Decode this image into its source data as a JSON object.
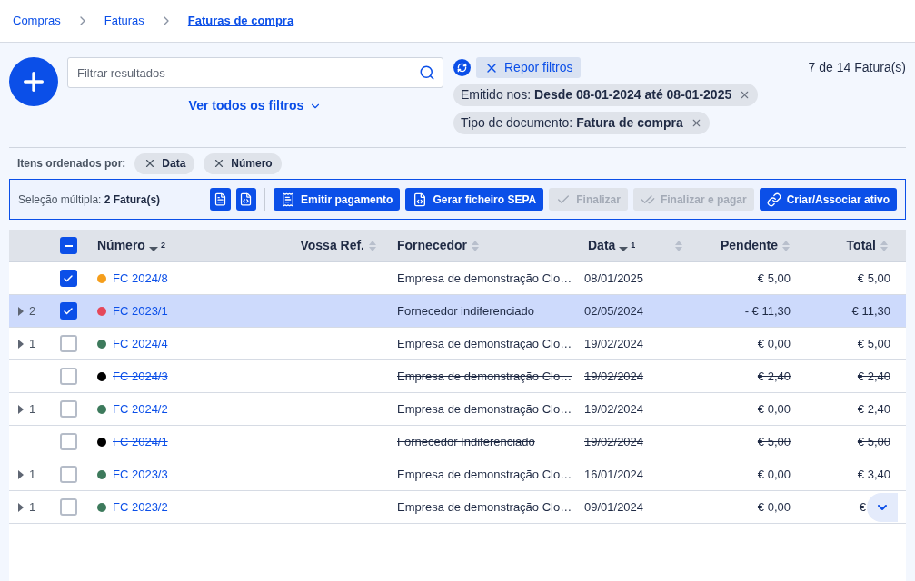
{
  "breadcrumb": [
    {
      "label": "Compras",
      "current": false
    },
    {
      "label": "Faturas",
      "current": false
    },
    {
      "label": "Faturas de compra",
      "current": true
    }
  ],
  "search": {
    "placeholder": "Filtrar resultados"
  },
  "all_filters_link": "Ver todos os filtros",
  "reset_filters": "Repor filtros",
  "result_count": "7 de 14 Fatura(s)",
  "active_filters": [
    {
      "label": "Emitido nos:",
      "value": "Desde 08-01-2024 até 08-01-2025"
    },
    {
      "label": "Tipo de documento:",
      "value": "Fatura de compra"
    }
  ],
  "sort": {
    "label": "Itens ordenados por:",
    "chips": [
      "Data",
      "Número"
    ]
  },
  "selection_bar": {
    "label": "Seleção múltipla:",
    "value": "2 Fatura(s)",
    "buttons": [
      {
        "label": "Emitir pagamento",
        "disabled": false
      },
      {
        "label": "Gerar ficheiro SEPA",
        "disabled": false
      },
      {
        "label": "Finalizar",
        "disabled": true
      },
      {
        "label": "Finalizar e pagar",
        "disabled": true
      },
      {
        "label": "Criar/Associar ativo",
        "disabled": false
      }
    ]
  },
  "table": {
    "select_all": {
      "indeterminate": true
    },
    "columns": [
      {
        "label": "Número",
        "sorted": true,
        "order": "2"
      },
      {
        "label": "Vossa Ref.",
        "sorted": false
      },
      {
        "label": "Fornecedor",
        "sorted": false
      },
      {
        "label": "Data",
        "sorted": true,
        "order": "1"
      },
      {
        "sorted": false
      },
      {
        "label": "Pendente",
        "sorted": false
      },
      {
        "label": "Total",
        "sorted": false
      }
    ],
    "rows": [
      {
        "count": null,
        "checked": true,
        "selected": false,
        "cancelled": false,
        "color": "#f59e1b",
        "number": "FC 2024/8",
        "supplier": "Empresa de demonstração Clo…",
        "date": "08/01/2025",
        "pending": "€ 5,00",
        "total": "€ 5,00"
      },
      {
        "count": "2",
        "checked": true,
        "selected": true,
        "cancelled": false,
        "color": "#e5485a",
        "number": "FC 2023/1",
        "supplier": "Fornecedor indiferenciado",
        "date": "02/05/2024",
        "pending": "- € 11,30",
        "total": "€ 11,30"
      },
      {
        "count": "1",
        "checked": false,
        "selected": false,
        "cancelled": false,
        "color": "#3d7a5c",
        "number": "FC 2024/4",
        "supplier": "Empresa de demonstração Clo…",
        "date": "19/02/2024",
        "pending": "€ 0,00",
        "total": "€ 5,00"
      },
      {
        "count": null,
        "checked": false,
        "selected": false,
        "cancelled": true,
        "color": "#000000",
        "number": "FC 2024/3",
        "supplier": "Empresa de demonstração Clo…",
        "date": "19/02/2024",
        "pending": "€ 2,40",
        "total": "€ 2,40"
      },
      {
        "count": "1",
        "checked": false,
        "selected": false,
        "cancelled": false,
        "color": "#3d7a5c",
        "number": "FC 2024/2",
        "supplier": "Empresa de demonstração Clo…",
        "date": "19/02/2024",
        "pending": "€ 0,00",
        "total": "€ 2,40"
      },
      {
        "count": null,
        "checked": false,
        "selected": false,
        "cancelled": true,
        "color": "#000000",
        "number": "FC 2024/1",
        "supplier": "Fornecedor Indiferenciado",
        "date": "19/02/2024",
        "pending": "€ 5,00",
        "total": "€ 5,00"
      },
      {
        "count": "1",
        "checked": false,
        "selected": false,
        "cancelled": false,
        "color": "#3d7a5c",
        "number": "FC 2023/3",
        "supplier": "Empresa de demonstração Clo…",
        "date": "16/01/2024",
        "pending": "€ 0,00",
        "total": "€ 3,40"
      },
      {
        "count": "1",
        "checked": false,
        "selected": false,
        "cancelled": false,
        "color": "#3d7a5c",
        "number": "FC 2023/2",
        "supplier": "Empresa de demonstração Clo…",
        "date": "09/01/2024",
        "pending": "€ 0,00",
        "total": "€"
      }
    ]
  }
}
